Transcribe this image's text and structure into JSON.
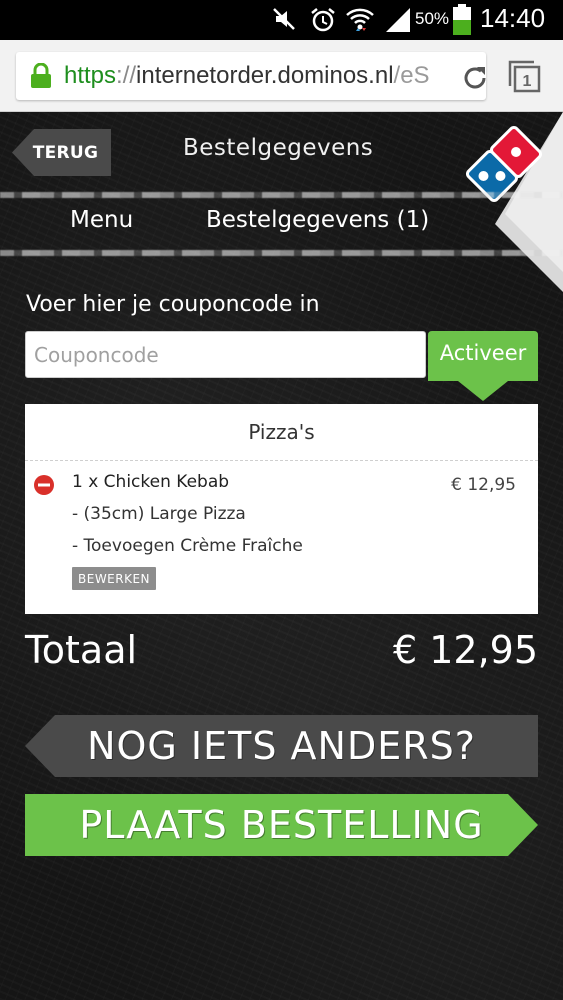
{
  "status_bar": {
    "battery_percent": "50%",
    "time": "14:40",
    "icons": [
      "mute-icon",
      "alarm-icon",
      "wifi-icon",
      "signal-icon",
      "battery-icon"
    ]
  },
  "browser": {
    "url_scheme": "https",
    "url_separator": "://",
    "url_host": "internetorder.dominos.nl",
    "url_path": "/eS",
    "tab_count": "1"
  },
  "header": {
    "back_label": "TERUG",
    "title": "Bestelgegevens"
  },
  "nav": {
    "menu_label": "Menu",
    "order_label": "Bestelgegevens (1)"
  },
  "coupon": {
    "label": "Voer hier je couponcode in",
    "placeholder": "Couponcode",
    "value": "",
    "button_label": "Activeer"
  },
  "order": {
    "section_title": "Pizza's",
    "items": [
      {
        "title": "1 x Chicken Kebab",
        "options": [
          "- (35cm) Large Pizza",
          "- Toevoegen Crème Fraîche"
        ],
        "price": "€ 12,95",
        "edit_label": "BEWERKEN"
      }
    ]
  },
  "total": {
    "label": "Totaal",
    "value": "€ 12,95"
  },
  "actions": {
    "more_label": "NOG IETS ANDERS?",
    "place_order_label": "PLAATS BESTELLING"
  },
  "colors": {
    "green": "#6cc24a",
    "dominos_blue": "#0b6aa8",
    "dominos_red": "#e31837",
    "dark_button": "#4a4a4a",
    "remove_red": "#d9302a"
  }
}
